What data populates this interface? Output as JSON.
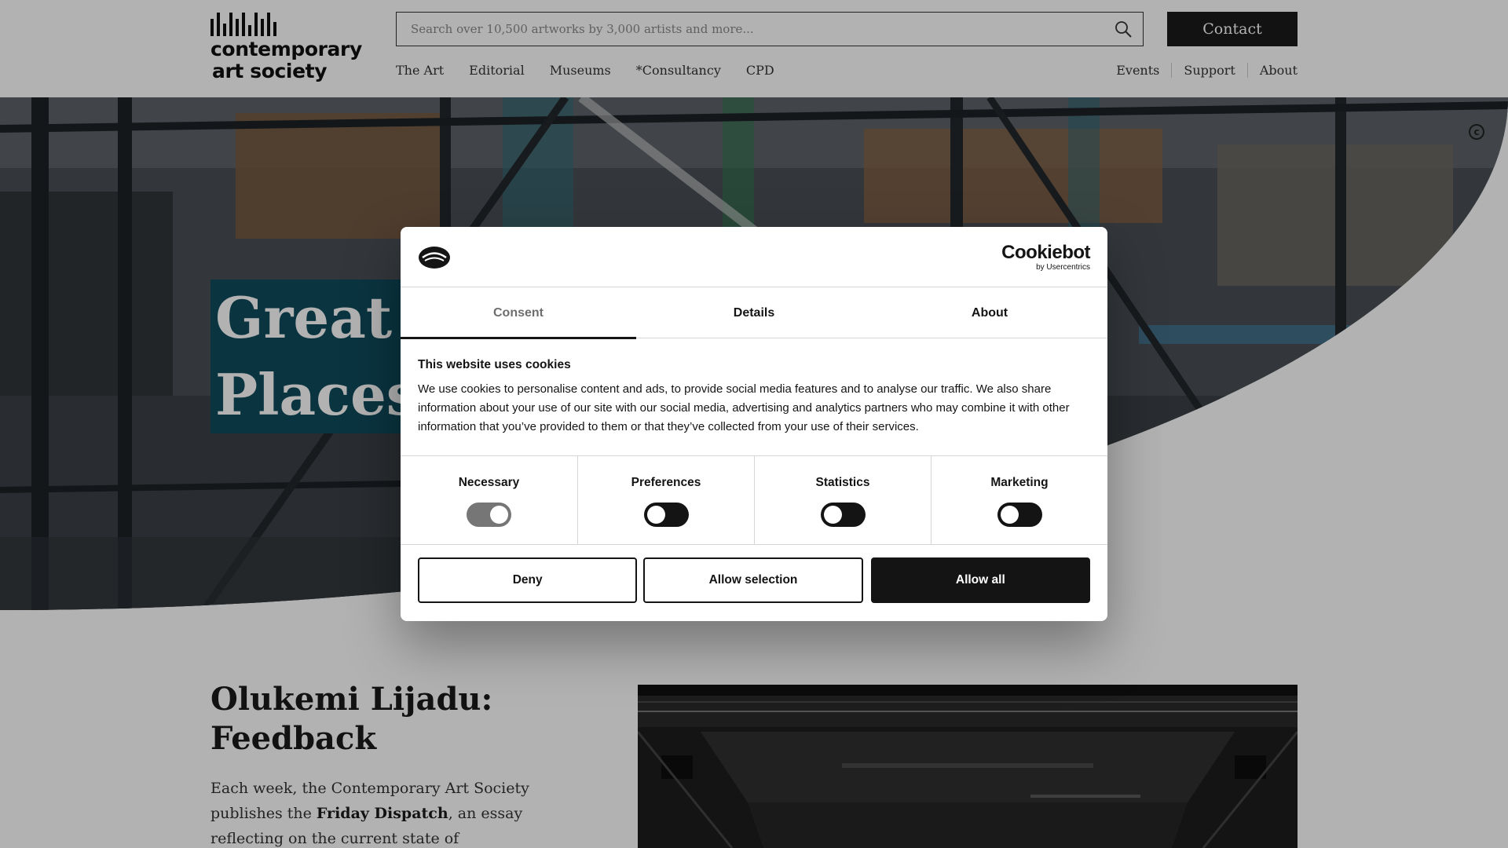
{
  "header": {
    "logo_line1": "contemporary",
    "logo_line2": "art society",
    "search_placeholder": "Search over 10,500 artworks by 3,000 artists and more...",
    "contact_label": "Contact",
    "main_nav": [
      "The Art",
      "Editorial",
      "Museums",
      "*Consultancy",
      "CPD"
    ],
    "sub_nav": [
      "Events",
      "Support",
      "About"
    ]
  },
  "hero": {
    "title_line1": "Great A",
    "title_line2": "Places",
    "copyright_symbol": "c"
  },
  "article": {
    "title": "Olukemi Lijadu: Feedback",
    "intro_before": "Each week, the Contemporary Art Society publishes the ",
    "intro_bold": "Friday Dispatch",
    "intro_after": ", an essay reflecting on the current state of"
  },
  "cookie_dialog": {
    "brand_name": "Cookiebot",
    "brand_by": "by Usercentrics",
    "tabs": [
      {
        "label": "Consent",
        "active": true
      },
      {
        "label": "Details",
        "active": false
      },
      {
        "label": "About",
        "active": false
      }
    ],
    "heading": "This website uses cookies",
    "body": "We use cookies to personalise content and ads, to provide social media features and to analyse our traffic. We also share information about your use of our site with our social media, advertising and analytics partners who may combine it with other information that you’ve provided to them or that they’ve collected from your use of their services.",
    "categories": [
      {
        "label": "Necessary",
        "on": true,
        "disabled": true
      },
      {
        "label": "Preferences",
        "on": false,
        "disabled": false
      },
      {
        "label": "Statistics",
        "on": false,
        "disabled": false
      },
      {
        "label": "Marketing",
        "on": false,
        "disabled": false
      }
    ],
    "buttons": {
      "deny": "Deny",
      "allow_selection": "Allow selection",
      "allow_all": "Allow all"
    }
  },
  "colors": {
    "hero_title_bg": "#0f4b5c",
    "primary_dark": "#141414",
    "toggle_disabled": "#767676",
    "overlay": "rgba(0,0,0,0.30)"
  },
  "icons": {
    "search": "search-icon",
    "cookiebot_logo": "cookiebot-logo-icon",
    "copyright": "copyright-icon"
  }
}
